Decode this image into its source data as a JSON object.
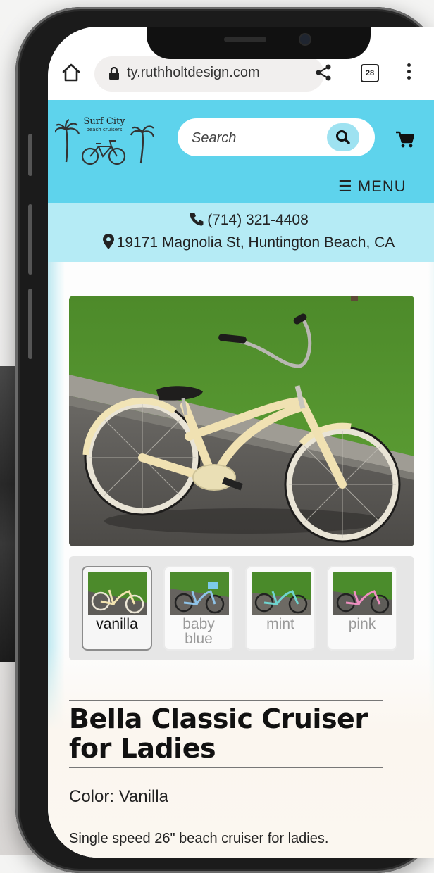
{
  "browser": {
    "url": "ty.ruthholtdesign.com",
    "tab_count": "28"
  },
  "header": {
    "logo_line1": "Surf City",
    "logo_line2": "beach cruisers",
    "search_placeholder": "Search",
    "menu_label": "☰ MENU",
    "accent_color": "#5ed3ec"
  },
  "contact": {
    "phone": "(714) 321-4408",
    "address": "19171 Magnolia St, Huntington Beach, CA"
  },
  "product": {
    "swatches": [
      {
        "label": "vanilla",
        "frame_color": "#f2e3b0",
        "active": true
      },
      {
        "label": "baby blue",
        "frame_color": "#8fc3e8",
        "active": false
      },
      {
        "label": "mint",
        "frame_color": "#6fd3cf",
        "active": false
      },
      {
        "label": "pink",
        "frame_color": "#ee8fc0",
        "active": false
      }
    ],
    "title": "Bella Classic Cruiser for Ladies",
    "color_line": "Color: Vanilla",
    "description": "Single speed 26\" beach cruiser for ladies."
  }
}
